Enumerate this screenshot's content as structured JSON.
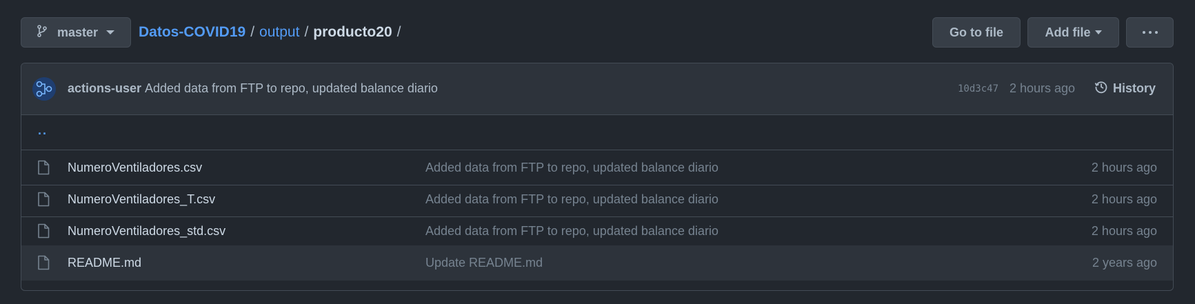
{
  "branch": {
    "label": "master",
    "icon": "git-branch-icon"
  },
  "breadcrumb": {
    "repo": "Datos-COVID19",
    "folder": "output",
    "current": "producto20",
    "sep1": "/",
    "sep2": "/",
    "sep3": "/"
  },
  "actions": {
    "goto_file": "Go to file",
    "add_file": "Add file",
    "more_icon": "kebab-horizontal-icon"
  },
  "latest_commit": {
    "author": "actions-user",
    "message": "Added data from FTP to repo, updated balance diario",
    "sha": "10d3c47",
    "time": "2 hours ago",
    "history_label": "History",
    "history_icon": "history-icon"
  },
  "parent_dir": "..",
  "files": [
    {
      "name": "NumeroVentiladores.csv",
      "message": "Added data from FTP to repo, updated balance diario",
      "time": "2 hours ago",
      "icon": "file-icon"
    },
    {
      "name": "NumeroVentiladores_T.csv",
      "message": "Added data from FTP to repo, updated balance diario",
      "time": "2 hours ago",
      "icon": "file-icon"
    },
    {
      "name": "NumeroVentiladores_std.csv",
      "message": "Added data from FTP to repo, updated balance diario",
      "time": "2 hours ago",
      "icon": "file-icon"
    },
    {
      "name": "README.md",
      "message": "Update README.md",
      "time": "2 years ago",
      "icon": "file-icon"
    }
  ],
  "colors": {
    "background": "#22272e",
    "surface": "#2d333b",
    "border": "#444c56",
    "link": "#539bf5",
    "text": "#adbac7",
    "muted": "#768390"
  }
}
